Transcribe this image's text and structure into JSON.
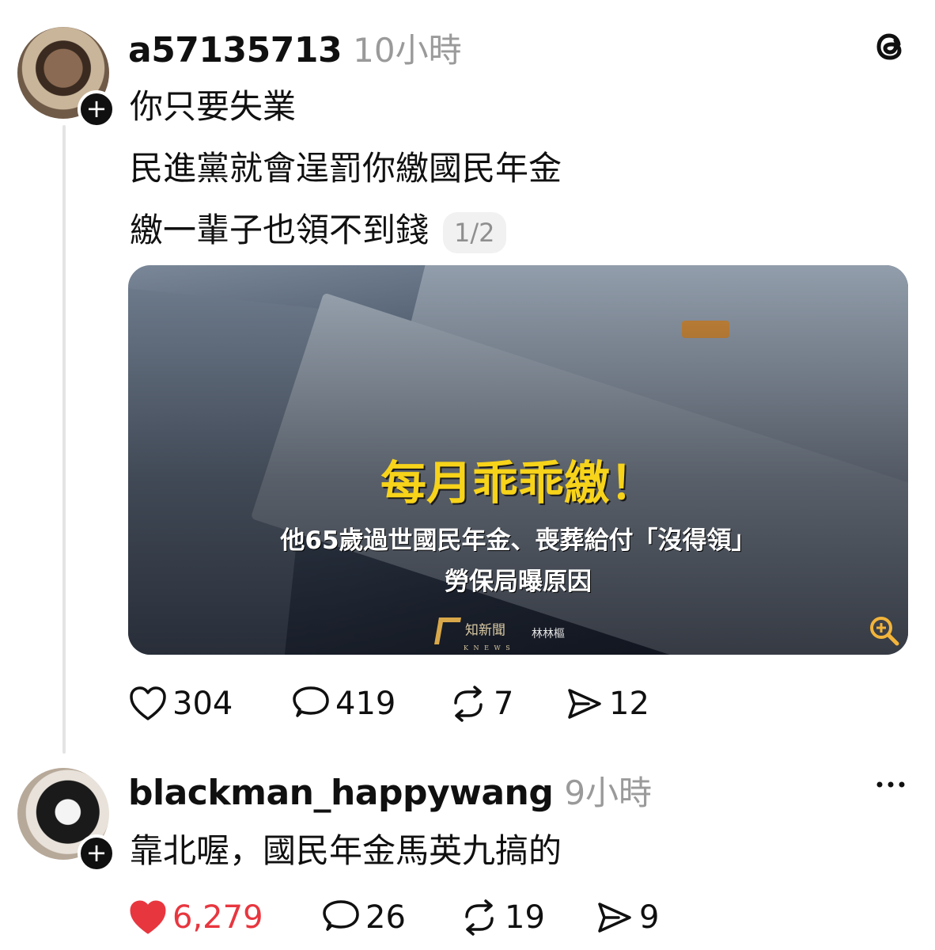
{
  "post": {
    "username": "a57135713",
    "time": "10小時",
    "lines": [
      "你只要失業",
      "民進黨就會逞罰你繳國民年金",
      "繳一輩子也領不到錢"
    ],
    "page_indicator": "1/2",
    "media": {
      "headline": "每月乖乖繳！",
      "subline1": "他65歲過世國民年金、喪葬給付「沒得領」",
      "subline2": "勞保局曝原因",
      "brand": "知新聞",
      "brand_sub": "K N E W S",
      "author": "林林樞"
    },
    "actions": {
      "likes": "304",
      "comments": "419",
      "reposts": "7",
      "shares": "12"
    }
  },
  "reply": {
    "username": "blackman_happywang",
    "time": "9小時",
    "text": "靠北喔，國民年金馬英九搞的",
    "actions": {
      "likes": "6,279",
      "comments": "26",
      "reposts": "19",
      "shares": "9"
    },
    "liked_color": "#e8363f"
  },
  "icons": [
    "threads-logo-icon",
    "more-options-icon",
    "heart-icon",
    "comment-icon",
    "repost-icon",
    "share-icon",
    "zoom-icon",
    "follow-plus-icon"
  ]
}
